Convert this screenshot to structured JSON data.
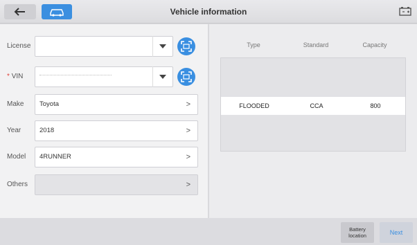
{
  "header": {
    "title": "Vehicle information",
    "back_icon": "back-arrow-icon",
    "home_icon": "car-home-icon",
    "battery_icon": "battery-icon",
    "accent": "#3b8fe0"
  },
  "form": {
    "license": {
      "label": "License",
      "value": ""
    },
    "vin": {
      "required_mark": "*",
      "label": "VIN",
      "value": ""
    },
    "make": {
      "label": "Make",
      "value": "Toyota"
    },
    "year": {
      "label": "Year",
      "value": "2018"
    },
    "model": {
      "label": "Model",
      "value": "4RUNNER"
    },
    "others": {
      "label": "Others",
      "value": ""
    },
    "chevron": ">"
  },
  "battery_table": {
    "headers": [
      "Type",
      "Standard",
      "Capacity"
    ],
    "rows": [
      {
        "type": "",
        "standard": "",
        "capacity": ""
      },
      {
        "type": "",
        "standard": "",
        "capacity": ""
      },
      {
        "type": "FLOODED",
        "standard": "CCA",
        "capacity": "800",
        "selected": true
      },
      {
        "type": "",
        "standard": "",
        "capacity": ""
      },
      {
        "type": "",
        "standard": "",
        "capacity": ""
      }
    ]
  },
  "footer": {
    "battery_location_line1": "Battery",
    "battery_location_line2": "location",
    "next_label": "Next"
  }
}
